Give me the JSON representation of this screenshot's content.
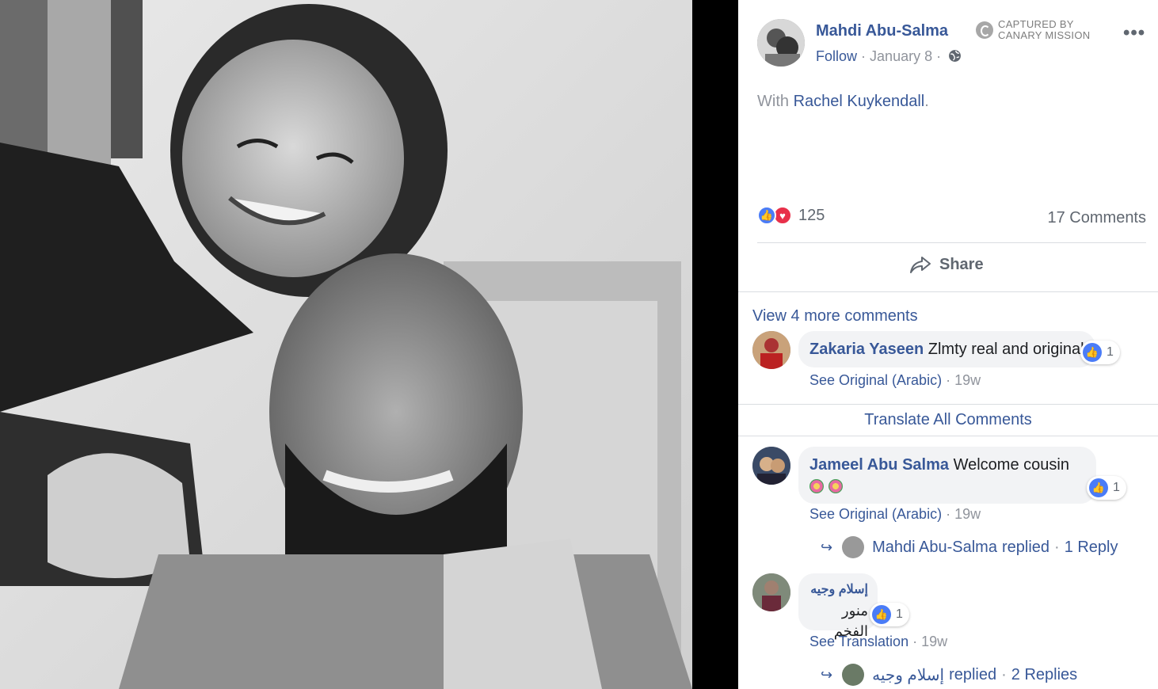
{
  "post": {
    "author": "Mahdi Abu-Salma",
    "follow_label": "Follow",
    "date": "January 8",
    "separator": "·",
    "with_prefix": "With",
    "tagged": "Rachel Kuykendall",
    "tagged_suffix": ".",
    "reaction_count": "125",
    "comments_count": "17 Comments",
    "share_label": "Share",
    "more_label": "•••"
  },
  "captured_badge": {
    "line1": "CAPTURED BY",
    "line2": "CANARY MISSION"
  },
  "comments_section": {
    "view_more": "View 4 more comments",
    "translate_all": "Translate All Comments",
    "comments": [
      {
        "name": "Zakaria Yaseen",
        "text": "Zlmty real and original",
        "likes": "1",
        "action": "See Original (Arabic)",
        "time": "19w"
      },
      {
        "name": "Jameel Abu Salma",
        "text": "Welcome cousin",
        "likes": "1",
        "action": "See Original (Arabic)",
        "time": "19w",
        "reply": {
          "name": "Mahdi Abu-Salma",
          "verb": "replied",
          "count": "1 Reply"
        }
      },
      {
        "name": "إسلام وجيه",
        "text": "منور الفخم",
        "likes": "1",
        "action": "See Translation",
        "time": "19w",
        "reply": {
          "name": "إسلام وجيه",
          "verb": "replied",
          "count": "2 Replies"
        }
      }
    ]
  },
  "colors": {
    "link": "#385898",
    "muted": "#90949c",
    "like": "#4a7cf7",
    "love": "#e8304a"
  }
}
